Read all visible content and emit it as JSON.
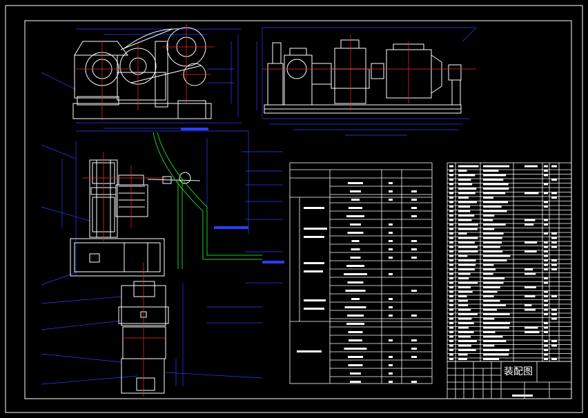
{
  "title_block": {
    "drawing_title": "装配图"
  },
  "colors": {
    "background": "#000000",
    "frame": "#ffffff",
    "outline": "#ffffff",
    "dimension": "#2a3fff",
    "centerline": "#ff2a2a",
    "pipe": "#22cc22",
    "highlight_bar": "#2a3fff"
  },
  "views": {
    "top_left": "front-elevation",
    "top_right": "side-elevation",
    "bottom_left": "plan-view",
    "middle": "technical-parameters-table",
    "right": "parts-list-table"
  }
}
